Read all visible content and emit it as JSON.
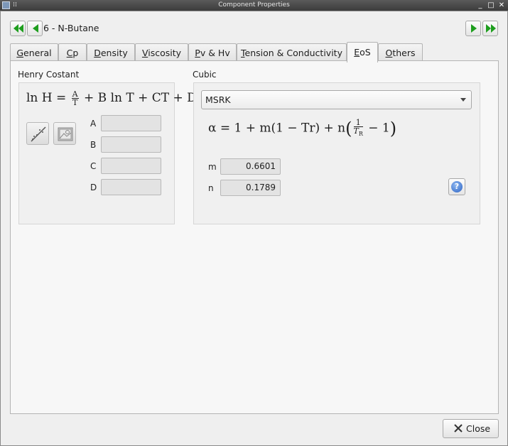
{
  "window": {
    "title": "Component Properties",
    "controls": [
      "_",
      "□",
      "✕"
    ]
  },
  "nav": {
    "first": "first-record",
    "prev": "previous-record",
    "next": "next-record",
    "last": "last-record",
    "component_title": "6 - N-Butane",
    "arrow_color": "#1e9e1e"
  },
  "tabs": [
    {
      "label": "General",
      "mnemonic": "G",
      "rest": "eneral"
    },
    {
      "label": "Cp",
      "mnemonic": "C",
      "rest": "p"
    },
    {
      "label": "Density",
      "mnemonic": "D",
      "rest": "ensity"
    },
    {
      "label": "Viscosity",
      "mnemonic": "V",
      "rest": "iscosity"
    },
    {
      "label": "Pv & Hv",
      "mnemonic": "P",
      "rest": "v & Hv"
    },
    {
      "label": "Tension & Conductivity",
      "mnemonic": "T",
      "rest": "ension & Conductivity"
    },
    {
      "label": "EoS",
      "mnemonic": "E",
      "rest": "oS"
    },
    {
      "label": "Others",
      "mnemonic": "O",
      "rest": "thers"
    }
  ],
  "active_tab": "EoS",
  "henry": {
    "group_label": "Henry Costant",
    "formula": {
      "lhs": "ln H =",
      "frac_num": "A",
      "frac_den": "T",
      "rhs": "+ B ln T + CT + D"
    },
    "params": [
      {
        "label": "A",
        "value": ""
      },
      {
        "label": "B",
        "value": ""
      },
      {
        "label": "C",
        "value": ""
      },
      {
        "label": "D",
        "value": ""
      }
    ]
  },
  "cubic": {
    "group_label": "Cubic",
    "selected_model": "MSRK",
    "formula": {
      "lhs": "α = 1 + m(1 − Tr) + n",
      "frac_num": "1",
      "frac_den": "T",
      "frac_den_sub": "R",
      "tail": "− 1"
    },
    "params": [
      {
        "label": "m",
        "value": "0.6601"
      },
      {
        "label": "n",
        "value": "0.1789"
      }
    ],
    "help_glyph": "?"
  },
  "footer": {
    "close_label": "Close"
  }
}
